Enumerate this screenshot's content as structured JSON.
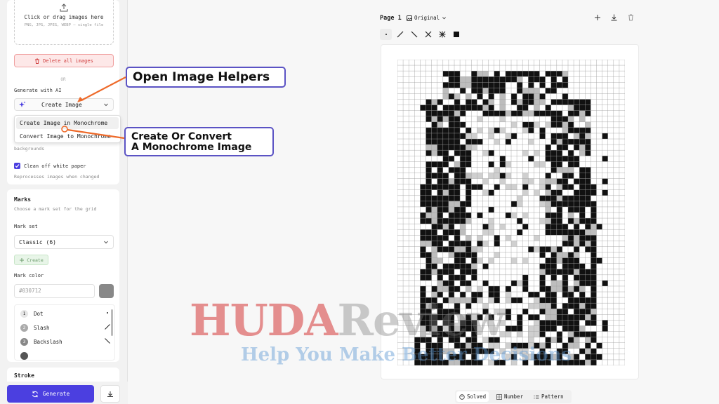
{
  "sidebar": {
    "upload": {
      "title": "Click or drag images here",
      "formats": "PNG, JPG, JPEG, WEBP — single file",
      "delete_label": "Delete all images",
      "or_label": "OR"
    },
    "ai": {
      "section_label": "Generate with AI",
      "selected": "Create Image",
      "menu_items": [
        "Create Image in Monochrome",
        "Convert Image to Monochrome"
      ]
    },
    "backgrounds_hint": "backgrounds",
    "clean_label": "Clean off white paper",
    "clean_checked": true,
    "reprocess_hint": "Reprocesses images when changed",
    "marks": {
      "title": "Marks",
      "subtitle": "Choose a mark set for the grid",
      "set_label": "Mark set",
      "set_value": "Classic (6)",
      "create_label": "Create",
      "color_label": "Mark color",
      "color_placeholder": "#030712",
      "color_swatch": "#888888",
      "items": [
        {
          "num": "1",
          "name": "Dot",
          "glyph": "dot-icon"
        },
        {
          "num": "2",
          "name": "Slash",
          "glyph": "slash-icon"
        },
        {
          "num": "3",
          "name": "Backslash",
          "glyph": "backslash-icon"
        }
      ]
    },
    "stroke_title": "Stroke",
    "generate_label": "Generate"
  },
  "main": {
    "page_label": "Page 1",
    "view_label": "Original",
    "tools": [
      "dot-icon",
      "slash-icon",
      "backslash-icon",
      "cross-icon",
      "asterisk-icon",
      "square-icon"
    ],
    "view_tabs": [
      "Solved",
      "Number",
      "Pattern"
    ],
    "active_tab": "Solved"
  },
  "annotations": {
    "callout1": "Open Image Helpers",
    "callout2_line1": "Create Or Convert",
    "callout2_line2": "A Monochrome Image",
    "accent": "#5b53c4",
    "arrow_color": "#ee6a2a"
  },
  "watermark": {
    "part1": "HUDA",
    "part2": "Review",
    "tagline": "Help You Make Better Decisions"
  },
  "colors": {
    "primary": "#4b3fe0",
    "danger": "#d04040",
    "danger_bg": "#fde8e8"
  }
}
